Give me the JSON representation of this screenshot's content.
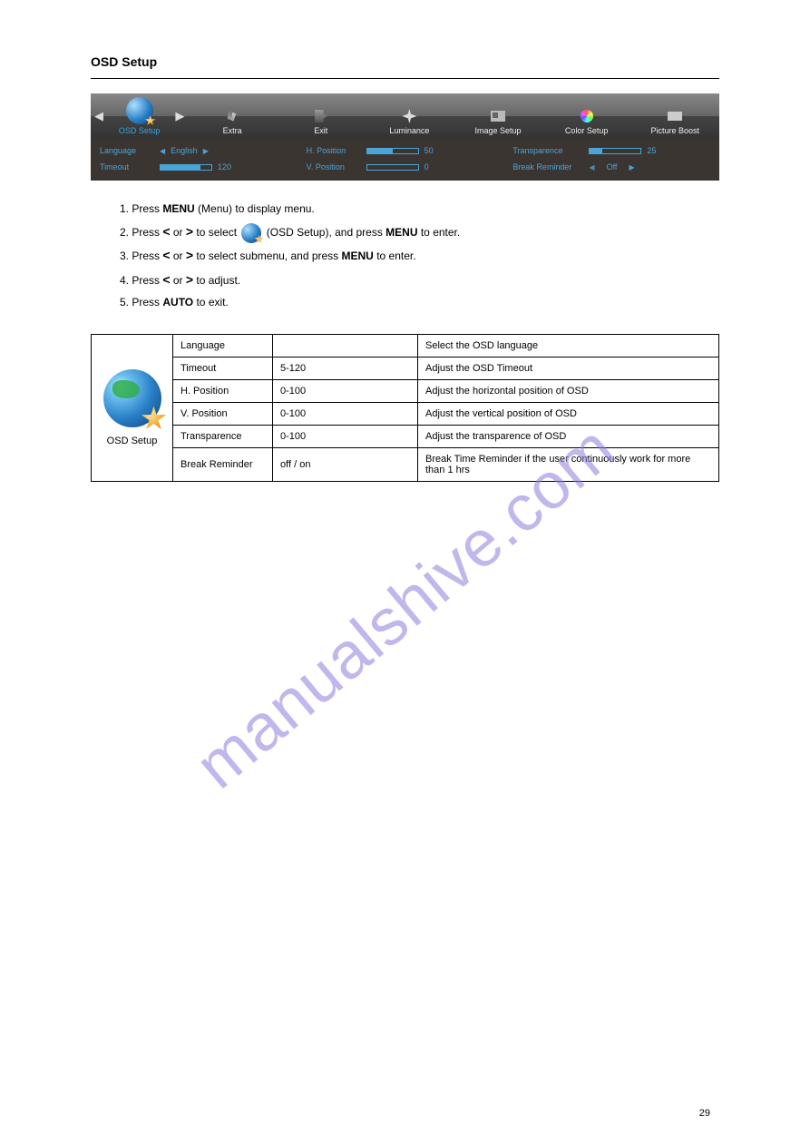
{
  "page_number": "29",
  "section_title": "OSD Setup",
  "watermark": "manualshive.com",
  "osd": {
    "tabs": [
      {
        "label": "OSD Setup",
        "selected": true
      },
      {
        "label": "Extra"
      },
      {
        "label": "Exit"
      },
      {
        "label": "Luminance"
      },
      {
        "label": "Image Setup"
      },
      {
        "label": "Color Setup"
      },
      {
        "label": "Picture Boost"
      }
    ],
    "rows": {
      "language": {
        "label": "Language",
        "value": "English"
      },
      "timeout": {
        "label": "Timeout",
        "value": "120",
        "fill": 78
      },
      "hpos": {
        "label": "H. Position",
        "value": "50",
        "fill": 50
      },
      "vpos": {
        "label": "V. Position",
        "value": "0",
        "fill": 0
      },
      "transp": {
        "label": "Transparence",
        "value": "25",
        "fill": 25
      },
      "breakrem": {
        "label": "Break Reminder",
        "value": "Off"
      }
    }
  },
  "steps": {
    "s1a": "1. Press ",
    "s1b": "MENU",
    "s1c": " (Menu) to display menu.",
    "s2a": "2. Press ",
    "s2b": " or ",
    "s2c": "  to select ",
    "s2d": " (OSD Setup), and press ",
    "s2e": "MENU",
    "s2f": " to enter.",
    "s3a": "3. Press ",
    "s3b": " or ",
    "s3c": "  to select submenu, and press ",
    "s3d": "MENU",
    "s3e": " to enter.",
    "s4a": "4. Press ",
    "s4b": " or ",
    "s4c": "  to adjust.",
    "s5a": "5. Press ",
    "s5b": "AUTO",
    "s5c": " to exit."
  },
  "table": {
    "caption": "OSD Setup",
    "rows": [
      {
        "name": "Language",
        "range": "",
        "desc": "Select the OSD language"
      },
      {
        "name": "Timeout",
        "range": "5-120",
        "desc": "Adjust the OSD Timeout"
      },
      {
        "name": "H. Position",
        "range": "0-100",
        "desc": "Adjust the horizontal position of OSD"
      },
      {
        "name": "V. Position",
        "range": "0-100",
        "desc": "Adjust the vertical position of OSD"
      },
      {
        "name": "Transparence",
        "range": "0-100",
        "desc": "Adjust the transparence of OSD"
      },
      {
        "name": "Break Reminder",
        "range": "off / on",
        "desc": "Break Time Reminder if the user continuously work for more than 1 hrs"
      }
    ]
  }
}
